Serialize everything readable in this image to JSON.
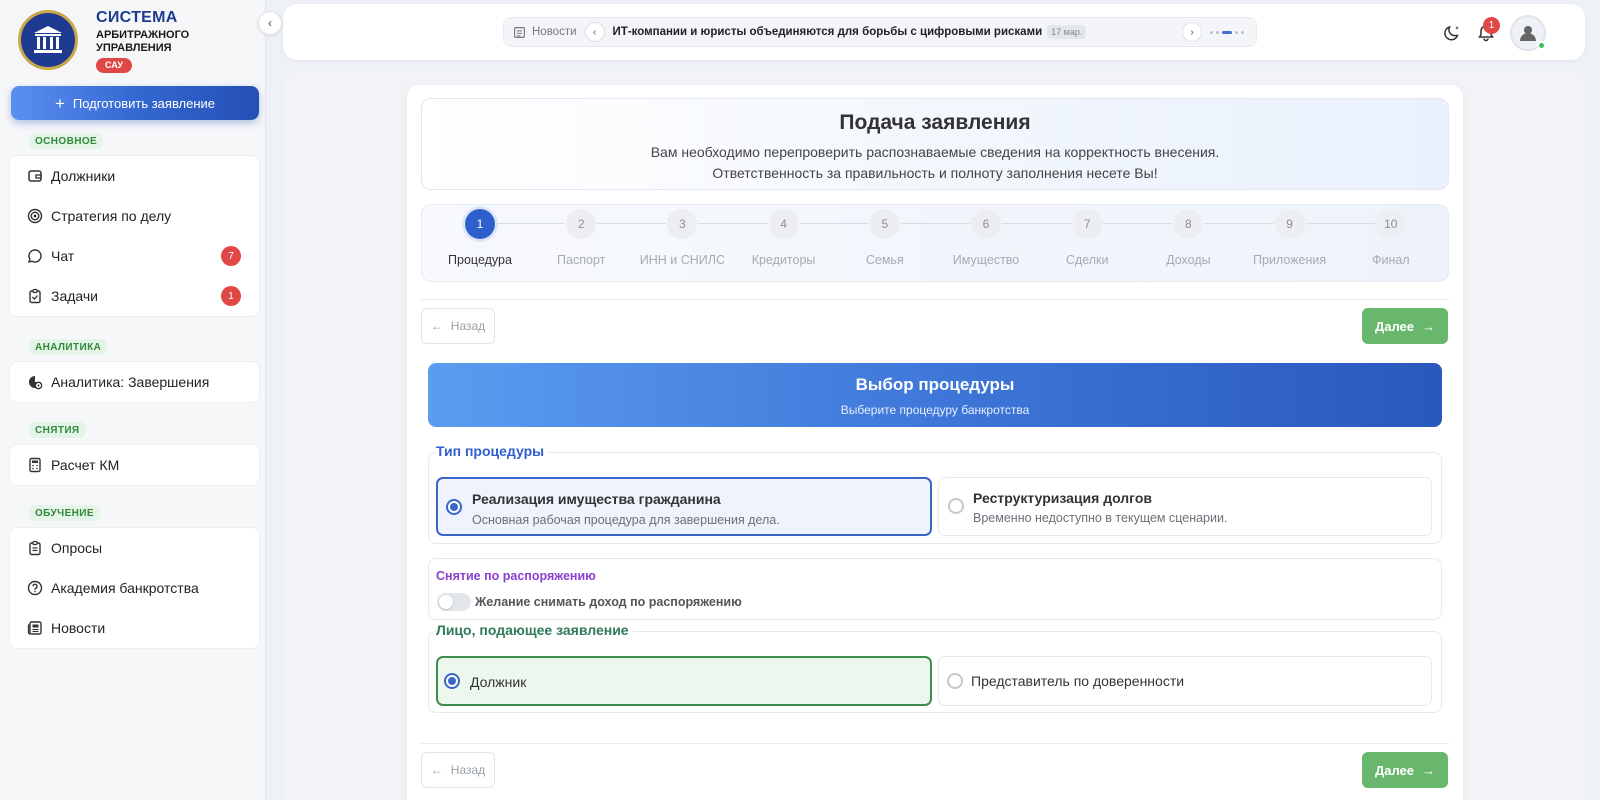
{
  "sidebar": {
    "brand": {
      "line1": "СИСТЕМА",
      "line2": "АРБИТРАЖНОГО",
      "line3": "УПРАВЛЕНИЯ",
      "badge": "САУ"
    },
    "prepare_button": "Подготовить заявление",
    "sections": [
      {
        "tag": "ОСНОВНОЕ",
        "items": [
          {
            "label": "Должники",
            "icon": "wallet-icon"
          },
          {
            "label": "Стратегия по делу",
            "icon": "target-icon"
          },
          {
            "label": "Чат",
            "icon": "chat-icon",
            "count": "7"
          },
          {
            "label": "Задачи",
            "icon": "clipboard-check-icon",
            "count": "1"
          }
        ]
      },
      {
        "tag": "АНАЛИТИКА",
        "items": [
          {
            "label": "Аналитика: Завершения",
            "icon": "analytics-icon"
          }
        ]
      },
      {
        "tag": "СНЯТИЯ",
        "items": [
          {
            "label": "Расчет КМ",
            "icon": "calculator-icon"
          }
        ]
      },
      {
        "tag": "ОБУЧЕНИЕ",
        "items": [
          {
            "label": "Опросы",
            "icon": "clipboard-icon"
          },
          {
            "label": "Академия банкротства",
            "icon": "question-icon"
          },
          {
            "label": "Новости",
            "icon": "newspaper-icon"
          }
        ]
      }
    ]
  },
  "topbar": {
    "ticker_label": "Новости",
    "headline": "ИТ-компании и юристы объединяются для борьбы с цифровыми рисками",
    "headline_date": "17 мар.",
    "notifications_count": "1"
  },
  "form": {
    "title": "Подача заявления",
    "subtitle_line1": "Вам необходимо перепроверить распознаваемые сведения на корректность внесения.",
    "subtitle_line2": "Ответственность за правильность и полноту заполнения несете Вы!",
    "steps": [
      {
        "num": "1",
        "label": "Процедура",
        "active": true
      },
      {
        "num": "2",
        "label": "Паспорт"
      },
      {
        "num": "3",
        "label": "ИНН и СНИЛС"
      },
      {
        "num": "4",
        "label": "Кредиторы"
      },
      {
        "num": "5",
        "label": "Семья"
      },
      {
        "num": "6",
        "label": "Имущество"
      },
      {
        "num": "7",
        "label": "Сделки"
      },
      {
        "num": "8",
        "label": "Доходы"
      },
      {
        "num": "9",
        "label": "Приложения"
      },
      {
        "num": "10",
        "label": "Финал"
      }
    ],
    "back_label": "Назад",
    "next_label": "Далее",
    "banner_title": "Выбор процедуры",
    "banner_subtitle": "Выберите процедуру банкротства",
    "procedure_type": {
      "legend": "Тип процедуры",
      "options": [
        {
          "title": "Реализация имущества гражданина",
          "desc": "Основная рабочая процедура для завершения дела.",
          "selected": true
        },
        {
          "title": "Реструктуризация долгов",
          "desc": "Временно недоступно в текущем сценарии.",
          "selected": false
        }
      ]
    },
    "withdrawal": {
      "legend": "Снятие по распоряжению",
      "toggle_label": "Желание снимать доход по распоряжению",
      "toggle_on": false
    },
    "applicant": {
      "legend": "Лицо, подающее заявление",
      "options": [
        {
          "title": "Должник",
          "selected": true
        },
        {
          "title": "Представитель по доверенности",
          "selected": false
        }
      ]
    }
  },
  "colors": {
    "primary": "#2f5fcc",
    "success": "#69b66d",
    "danger": "#e04848",
    "legend_blue": "#2f5fcc",
    "legend_purple": "#8a3fd0",
    "legend_green": "#2f7a57"
  }
}
